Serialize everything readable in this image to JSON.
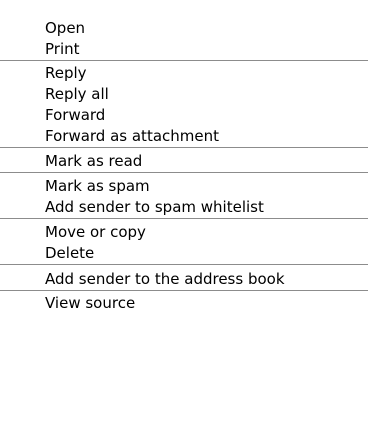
{
  "menu": {
    "groups": [
      {
        "items": [
          {
            "label": "Open"
          },
          {
            "label": "Print"
          }
        ]
      },
      {
        "items": [
          {
            "label": "Reply"
          },
          {
            "label": "Reply all"
          },
          {
            "label": "Forward"
          },
          {
            "label": "Forward as attachment"
          }
        ]
      },
      {
        "items": [
          {
            "label": "Mark as read"
          }
        ]
      },
      {
        "items": [
          {
            "label": "Mark as spam"
          },
          {
            "label": "Add sender to spam whitelist"
          }
        ]
      },
      {
        "items": [
          {
            "label": "Move or copy"
          },
          {
            "label": "Delete"
          }
        ]
      },
      {
        "items": [
          {
            "label": "Add sender to the address book"
          }
        ]
      },
      {
        "items": [
          {
            "label": "View source"
          }
        ]
      }
    ]
  }
}
